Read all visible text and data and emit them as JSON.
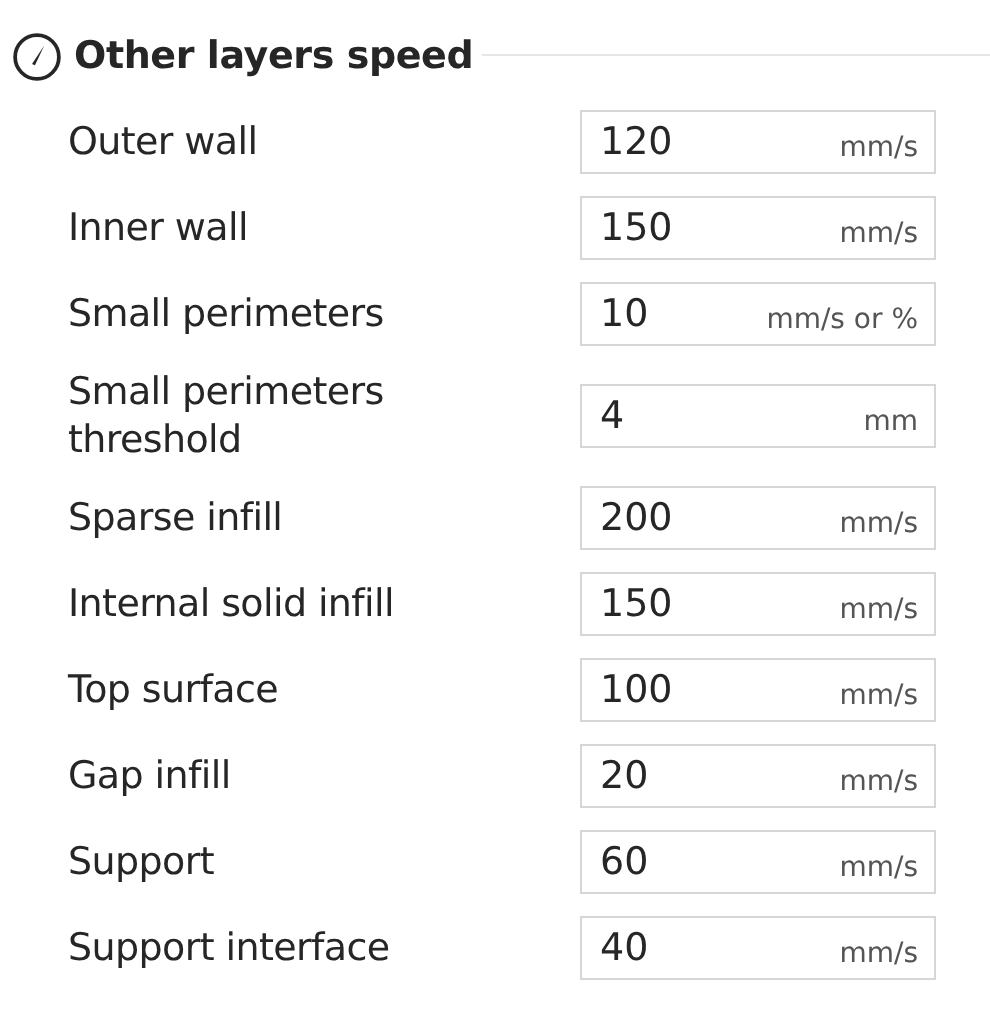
{
  "section": {
    "title": "Other layers speed"
  },
  "rows": [
    {
      "label": "Outer wall",
      "value": "120",
      "unit": "mm/s"
    },
    {
      "label": "Inner wall",
      "value": "150",
      "unit": "mm/s"
    },
    {
      "label": "Small perimeters",
      "value": "10",
      "unit": "mm/s or %"
    },
    {
      "label": "Small perimeters threshold",
      "value": "4",
      "unit": "mm"
    },
    {
      "label": "Sparse infill",
      "value": "200",
      "unit": "mm/s"
    },
    {
      "label": "Internal solid infill",
      "value": "150",
      "unit": "mm/s"
    },
    {
      "label": "Top surface",
      "value": "100",
      "unit": "mm/s"
    },
    {
      "label": "Gap infill",
      "value": "20",
      "unit": "mm/s"
    },
    {
      "label": "Support",
      "value": "60",
      "unit": "mm/s"
    },
    {
      "label": "Support interface",
      "value": "40",
      "unit": "mm/s"
    }
  ]
}
